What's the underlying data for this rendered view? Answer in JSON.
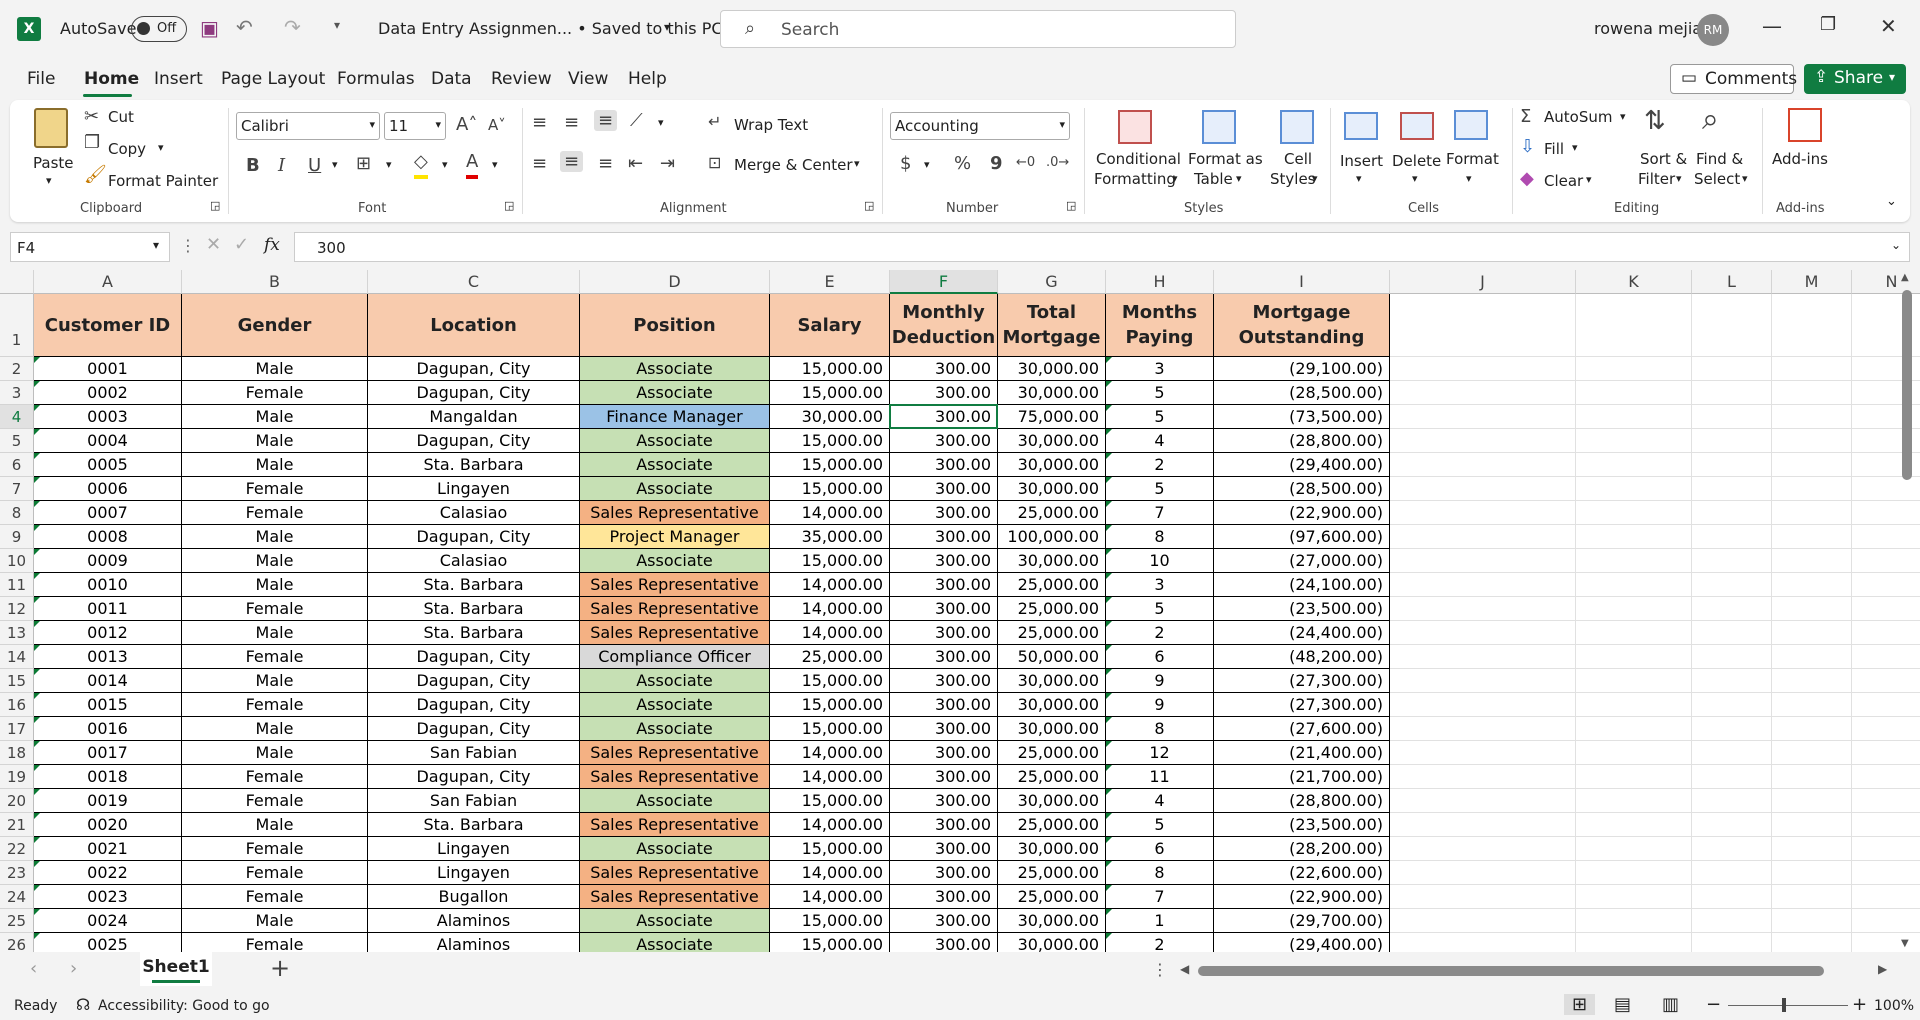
{
  "title_bar": {
    "autosave_label": "AutoSave",
    "autosave_state": "Off",
    "document_title": "Data Entry Assignmen... • Saved to this PC",
    "search_placeholder": "Search",
    "user_name": "rowena mejia",
    "user_initials": "RM"
  },
  "menu": [
    "File",
    "Home",
    "Insert",
    "Page Layout",
    "Formulas",
    "Data",
    "Review",
    "View",
    "Help"
  ],
  "active_menu": "Home",
  "top_buttons": {
    "comments": "Comments",
    "share": "Share"
  },
  "ribbon": {
    "clipboard": {
      "paste": "Paste",
      "cut": "Cut",
      "copy": "Copy",
      "format_painter": "Format Painter",
      "label": "Clipboard"
    },
    "font": {
      "name": "Calibri",
      "size": "11",
      "label": "Font"
    },
    "alignment": {
      "wrap_text": "Wrap Text",
      "merge_center": "Merge & Center",
      "label": "Alignment"
    },
    "number": {
      "format": "Accounting",
      "label": "Number"
    },
    "styles": {
      "conditional_1": "Conditional",
      "conditional_2": "Formatting",
      "format_table_1": "Format as",
      "format_table_2": "Table",
      "cell_styles_1": "Cell",
      "cell_styles_2": "Styles",
      "label": "Styles"
    },
    "cells": {
      "insert": "Insert",
      "delete": "Delete",
      "format": "Format",
      "label": "Cells"
    },
    "editing": {
      "autosum": "AutoSum",
      "fill": "Fill",
      "clear": "Clear",
      "sort_1": "Sort &",
      "sort_2": "Filter",
      "find_1": "Find &",
      "find_2": "Select",
      "label": "Editing"
    },
    "addins": {
      "addins": "Add-ins",
      "label": "Add-ins"
    }
  },
  "formula_bar": {
    "name_box": "F4",
    "fx": "fx",
    "value": "300"
  },
  "columns": [
    "A",
    "B",
    "C",
    "D",
    "E",
    "F",
    "G",
    "H",
    "I",
    "J",
    "K",
    "L",
    "M",
    "N"
  ],
  "active_column": "F",
  "headers": {
    "A": [
      "Customer ID"
    ],
    "B": [
      "Gender"
    ],
    "C": [
      "Location"
    ],
    "D": [
      "Position"
    ],
    "E": [
      "Salary"
    ],
    "F": [
      "Monthly",
      "Deduction"
    ],
    "G": [
      "Total",
      "Mortgage"
    ],
    "H": [
      "Months",
      "Paying"
    ],
    "I": [
      "Mortgage",
      "Outstanding"
    ]
  },
  "position_colors": {
    "Associate": "#c6e0b4",
    "Finance Manager": "#9bc2e6",
    "Sales Representative": "#f4b183",
    "Project Manager": "#ffe699",
    "Compliance Officer": "#d9d9d9"
  },
  "rows": [
    {
      "id": "0001",
      "gender": "Male",
      "location": "Dagupan, City",
      "position": "Associate",
      "salary": "15,000.00",
      "deduction": "300.00",
      "mortgage": "30,000.00",
      "months": "3",
      "outstanding": "(29,100.00)"
    },
    {
      "id": "0002",
      "gender": "Female",
      "location": "Dagupan, City",
      "position": "Associate",
      "salary": "15,000.00",
      "deduction": "300.00",
      "mortgage": "30,000.00",
      "months": "5",
      "outstanding": "(28,500.00)"
    },
    {
      "id": "0003",
      "gender": "Male",
      "location": "Mangaldan",
      "position": "Finance Manager",
      "salary": "30,000.00",
      "deduction": "300.00",
      "mortgage": "75,000.00",
      "months": "5",
      "outstanding": "(73,500.00)"
    },
    {
      "id": "0004",
      "gender": "Male",
      "location": "Dagupan, City",
      "position": "Associate",
      "salary": "15,000.00",
      "deduction": "300.00",
      "mortgage": "30,000.00",
      "months": "4",
      "outstanding": "(28,800.00)"
    },
    {
      "id": "0005",
      "gender": "Male",
      "location": "Sta. Barbara",
      "position": "Associate",
      "salary": "15,000.00",
      "deduction": "300.00",
      "mortgage": "30,000.00",
      "months": "2",
      "outstanding": "(29,400.00)"
    },
    {
      "id": "0006",
      "gender": "Female",
      "location": "Lingayen",
      "position": "Associate",
      "salary": "15,000.00",
      "deduction": "300.00",
      "mortgage": "30,000.00",
      "months": "5",
      "outstanding": "(28,500.00)"
    },
    {
      "id": "0007",
      "gender": "Female",
      "location": "Calasiao",
      "position": "Sales Representative",
      "salary": "14,000.00",
      "deduction": "300.00",
      "mortgage": "25,000.00",
      "months": "7",
      "outstanding": "(22,900.00)"
    },
    {
      "id": "0008",
      "gender": "Male",
      "location": "Dagupan, City",
      "position": "Project Manager",
      "salary": "35,000.00",
      "deduction": "300.00",
      "mortgage": "100,000.00",
      "months": "8",
      "outstanding": "(97,600.00)"
    },
    {
      "id": "0009",
      "gender": "Male",
      "location": "Calasiao",
      "position": "Associate",
      "salary": "15,000.00",
      "deduction": "300.00",
      "mortgage": "30,000.00",
      "months": "10",
      "outstanding": "(27,000.00)"
    },
    {
      "id": "0010",
      "gender": "Male",
      "location": "Sta. Barbara",
      "position": "Sales Representative",
      "salary": "14,000.00",
      "deduction": "300.00",
      "mortgage": "25,000.00",
      "months": "3",
      "outstanding": "(24,100.00)"
    },
    {
      "id": "0011",
      "gender": "Female",
      "location": "Sta. Barbara",
      "position": "Sales Representative",
      "salary": "14,000.00",
      "deduction": "300.00",
      "mortgage": "25,000.00",
      "months": "5",
      "outstanding": "(23,500.00)"
    },
    {
      "id": "0012",
      "gender": "Male",
      "location": "Sta. Barbara",
      "position": "Sales Representative",
      "salary": "14,000.00",
      "deduction": "300.00",
      "mortgage": "25,000.00",
      "months": "2",
      "outstanding": "(24,400.00)"
    },
    {
      "id": "0013",
      "gender": "Female",
      "location": "Dagupan, City",
      "position": "Compliance Officer",
      "salary": "25,000.00",
      "deduction": "300.00",
      "mortgage": "50,000.00",
      "months": "6",
      "outstanding": "(48,200.00)"
    },
    {
      "id": "0014",
      "gender": "Male",
      "location": "Dagupan, City",
      "position": "Associate",
      "salary": "15,000.00",
      "deduction": "300.00",
      "mortgage": "30,000.00",
      "months": "9",
      "outstanding": "(27,300.00)"
    },
    {
      "id": "0015",
      "gender": "Female",
      "location": "Dagupan, City",
      "position": "Associate",
      "salary": "15,000.00",
      "deduction": "300.00",
      "mortgage": "30,000.00",
      "months": "9",
      "outstanding": "(27,300.00)"
    },
    {
      "id": "0016",
      "gender": "Male",
      "location": "Dagupan, City",
      "position": "Associate",
      "salary": "15,000.00",
      "deduction": "300.00",
      "mortgage": "30,000.00",
      "months": "8",
      "outstanding": "(27,600.00)"
    },
    {
      "id": "0017",
      "gender": "Male",
      "location": "San Fabian",
      "position": "Sales Representative",
      "salary": "14,000.00",
      "deduction": "300.00",
      "mortgage": "25,000.00",
      "months": "12",
      "outstanding": "(21,400.00)"
    },
    {
      "id": "0018",
      "gender": "Female",
      "location": "Dagupan, City",
      "position": "Sales Representative",
      "salary": "14,000.00",
      "deduction": "300.00",
      "mortgage": "25,000.00",
      "months": "11",
      "outstanding": "(21,700.00)"
    },
    {
      "id": "0019",
      "gender": "Female",
      "location": "San Fabian",
      "position": "Associate",
      "salary": "15,000.00",
      "deduction": "300.00",
      "mortgage": "30,000.00",
      "months": "4",
      "outstanding": "(28,800.00)"
    },
    {
      "id": "0020",
      "gender": "Male",
      "location": "Sta. Barbara",
      "position": "Sales Representative",
      "salary": "14,000.00",
      "deduction": "300.00",
      "mortgage": "25,000.00",
      "months": "5",
      "outstanding": "(23,500.00)"
    },
    {
      "id": "0021",
      "gender": "Female",
      "location": "Lingayen",
      "position": "Associate",
      "salary": "15,000.00",
      "deduction": "300.00",
      "mortgage": "30,000.00",
      "months": "6",
      "outstanding": "(28,200.00)"
    },
    {
      "id": "0022",
      "gender": "Female",
      "location": "Lingayen",
      "position": "Sales Representative",
      "salary": "14,000.00",
      "deduction": "300.00",
      "mortgage": "25,000.00",
      "months": "8",
      "outstanding": "(22,600.00)"
    },
    {
      "id": "0023",
      "gender": "Female",
      "location": "Bugallon",
      "position": "Sales Representative",
      "salary": "14,000.00",
      "deduction": "300.00",
      "mortgage": "25,000.00",
      "months": "7",
      "outstanding": "(22,900.00)"
    },
    {
      "id": "0024",
      "gender": "Male",
      "location": "Alaminos",
      "position": "Associate",
      "salary": "15,000.00",
      "deduction": "300.00",
      "mortgage": "30,000.00",
      "months": "1",
      "outstanding": "(29,700.00)"
    },
    {
      "id": "0025",
      "gender": "Female",
      "location": "Alaminos",
      "position": "Associate",
      "salary": "15,000.00",
      "deduction": "300.00",
      "mortgage": "30,000.00",
      "months": "2",
      "outstanding": "(29,400.00)"
    }
  ],
  "row_numbers": [
    "1",
    "2",
    "3",
    "4",
    "5",
    "6",
    "7",
    "8",
    "9",
    "10",
    "11",
    "12",
    "13",
    "14",
    "15",
    "16",
    "17",
    "18",
    "19",
    "20",
    "21",
    "22",
    "23",
    "24",
    "25",
    "26"
  ],
  "active_row": "4",
  "sheet_tab": "Sheet1",
  "status": {
    "ready": "Ready",
    "accessibility": "Accessibility: Good to go",
    "zoom": "100%"
  }
}
